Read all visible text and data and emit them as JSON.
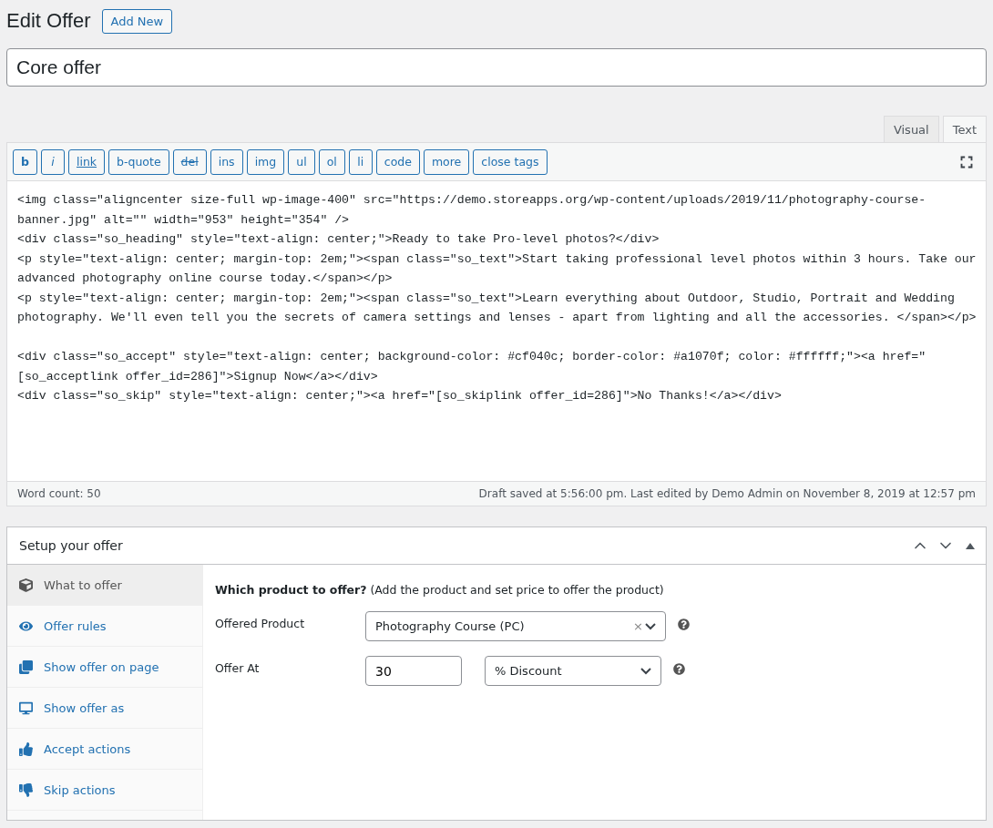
{
  "header": {
    "title": "Edit Offer",
    "add_new": "Add New"
  },
  "title_field": {
    "value": "Core offer"
  },
  "editor": {
    "tabs": [
      {
        "label": "Visual",
        "selected": false
      },
      {
        "label": "Text",
        "selected": true
      }
    ],
    "buttons": [
      {
        "label": "b",
        "kind": "bold"
      },
      {
        "label": "i",
        "kind": "italic"
      },
      {
        "label": "link",
        "kind": "underline"
      },
      {
        "label": "b-quote",
        "kind": "plain"
      },
      {
        "label": "del",
        "kind": "strike"
      },
      {
        "label": "ins",
        "kind": "plain"
      },
      {
        "label": "img",
        "kind": "plain"
      },
      {
        "label": "ul",
        "kind": "plain"
      },
      {
        "label": "ol",
        "kind": "plain"
      },
      {
        "label": "li",
        "kind": "plain"
      },
      {
        "label": "code",
        "kind": "plain"
      },
      {
        "label": "more",
        "kind": "plain"
      },
      {
        "label": "close tags",
        "kind": "plain"
      }
    ],
    "blocks": [
      {
        "lines": [
          "<img class=\"aligncenter size-full wp-image-400\" src=\"https://demo.storeapps.org/wp-content/uploads/2019/11/photography-course-",
          "banner.jpg\" alt=\"\" width=\"953\" height=\"354\" />",
          "<div class=\"so_heading\" style=\"text-align: center;\">Ready to take Pro-level photos?</div>",
          "<p style=\"text-align: center; margin-top: 2em;\"><span class=\"so_text\">Start taking professional level photos within 3 hours. Take our",
          "advanced photography online course today.</span></p>",
          "<p style=\"text-align: center; margin-top: 2em;\"><span class=\"so_text\">Learn everything about Outdoor, Studio, Portrait and Wedding",
          "photography. We'll even tell you the secrets of camera settings and lenses - apart from lighting and all the accessories. </span></p>"
        ]
      },
      {
        "lines": [
          "<div class=\"so_accept\" style=\"text-align: center; background-color: #cf040c; border-color: #a1070f; color: #ffffff;\"><a href=\"",
          "[so_acceptlink offer_id=286]\">Signup Now</a></div>",
          "<div class=\"so_skip\" style=\"text-align: center;\"><a href=\"[so_skiplink offer_id=286]\">No Thanks!</a></div>"
        ]
      }
    ],
    "word_count": "Word count: 50",
    "draft_status": "Draft saved at 5:56:00 pm. Last edited by Demo Admin on November 8, 2019 at 12:57 pm"
  },
  "metabox": {
    "title": "Setup your offer",
    "tabs": [
      {
        "label": "What to offer",
        "selected": true
      },
      {
        "label": "Offer rules",
        "selected": false
      },
      {
        "label": "Show offer on page",
        "selected": false
      },
      {
        "label": "Show offer as",
        "selected": false
      },
      {
        "label": "Accept actions",
        "selected": false
      },
      {
        "label": "Skip actions",
        "selected": false
      }
    ],
    "question": "**Which product to offer?** (Add the product and set price to offer the product)",
    "offered_product": {
      "label": "Offered Product",
      "value": "Photography Course (PC)",
      "clear": "×"
    },
    "offer_at": {
      "label": "Offer At",
      "value": "30",
      "type": "% Discount"
    }
  }
}
